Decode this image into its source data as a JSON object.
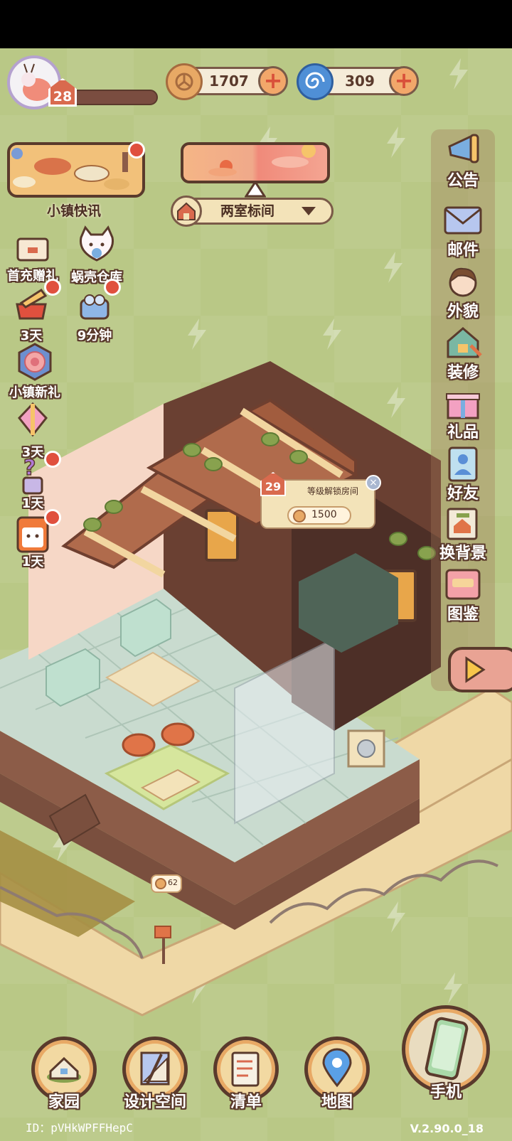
{
  "player": {
    "level": "28"
  },
  "currencies": [
    {
      "name": "coin",
      "value": "1707",
      "color": "#e8a965"
    },
    {
      "name": "snail-shell",
      "value": "309",
      "color": "#4f8fd6"
    }
  ],
  "town_news": {
    "label": "小镇快讯"
  },
  "room": {
    "name": "两室标间"
  },
  "left_menu": [
    {
      "label": "首充赠礼"
    },
    {
      "label": "蜗壳仓库"
    },
    {
      "label": "3天"
    },
    {
      "label": "9分钟"
    },
    {
      "label": "小镇新礼"
    },
    {
      "label": "3天"
    },
    {
      "label": "1天"
    },
    {
      "label": "1天"
    }
  ],
  "right_menu": [
    {
      "label": "公告",
      "icon": "megaphone-icon"
    },
    {
      "label": "邮件",
      "icon": "mail-icon"
    },
    {
      "label": "外貌",
      "icon": "face-icon"
    },
    {
      "label": "装修",
      "icon": "renovate-icon"
    },
    {
      "label": "礼品",
      "icon": "gift-icon"
    },
    {
      "label": "好友",
      "icon": "friends-icon"
    },
    {
      "label": "换背景",
      "icon": "background-icon"
    },
    {
      "label": "图鉴",
      "icon": "album-icon"
    }
  ],
  "unlock": {
    "level": "29",
    "title": "等级解锁房间",
    "cost": "1500"
  },
  "mailbox": {
    "count": "62"
  },
  "bottom_nav": [
    {
      "label": "家园",
      "icon": "home-icon"
    },
    {
      "label": "设计空间",
      "icon": "design-icon"
    },
    {
      "label": "清单",
      "icon": "list-icon"
    },
    {
      "label": "地图",
      "icon": "map-pin-icon"
    },
    {
      "label": "手机",
      "icon": "phone-icon"
    }
  ],
  "footer": {
    "id": "ID：pVHkWPFFHepC",
    "version": "V.2.90.0_18"
  }
}
